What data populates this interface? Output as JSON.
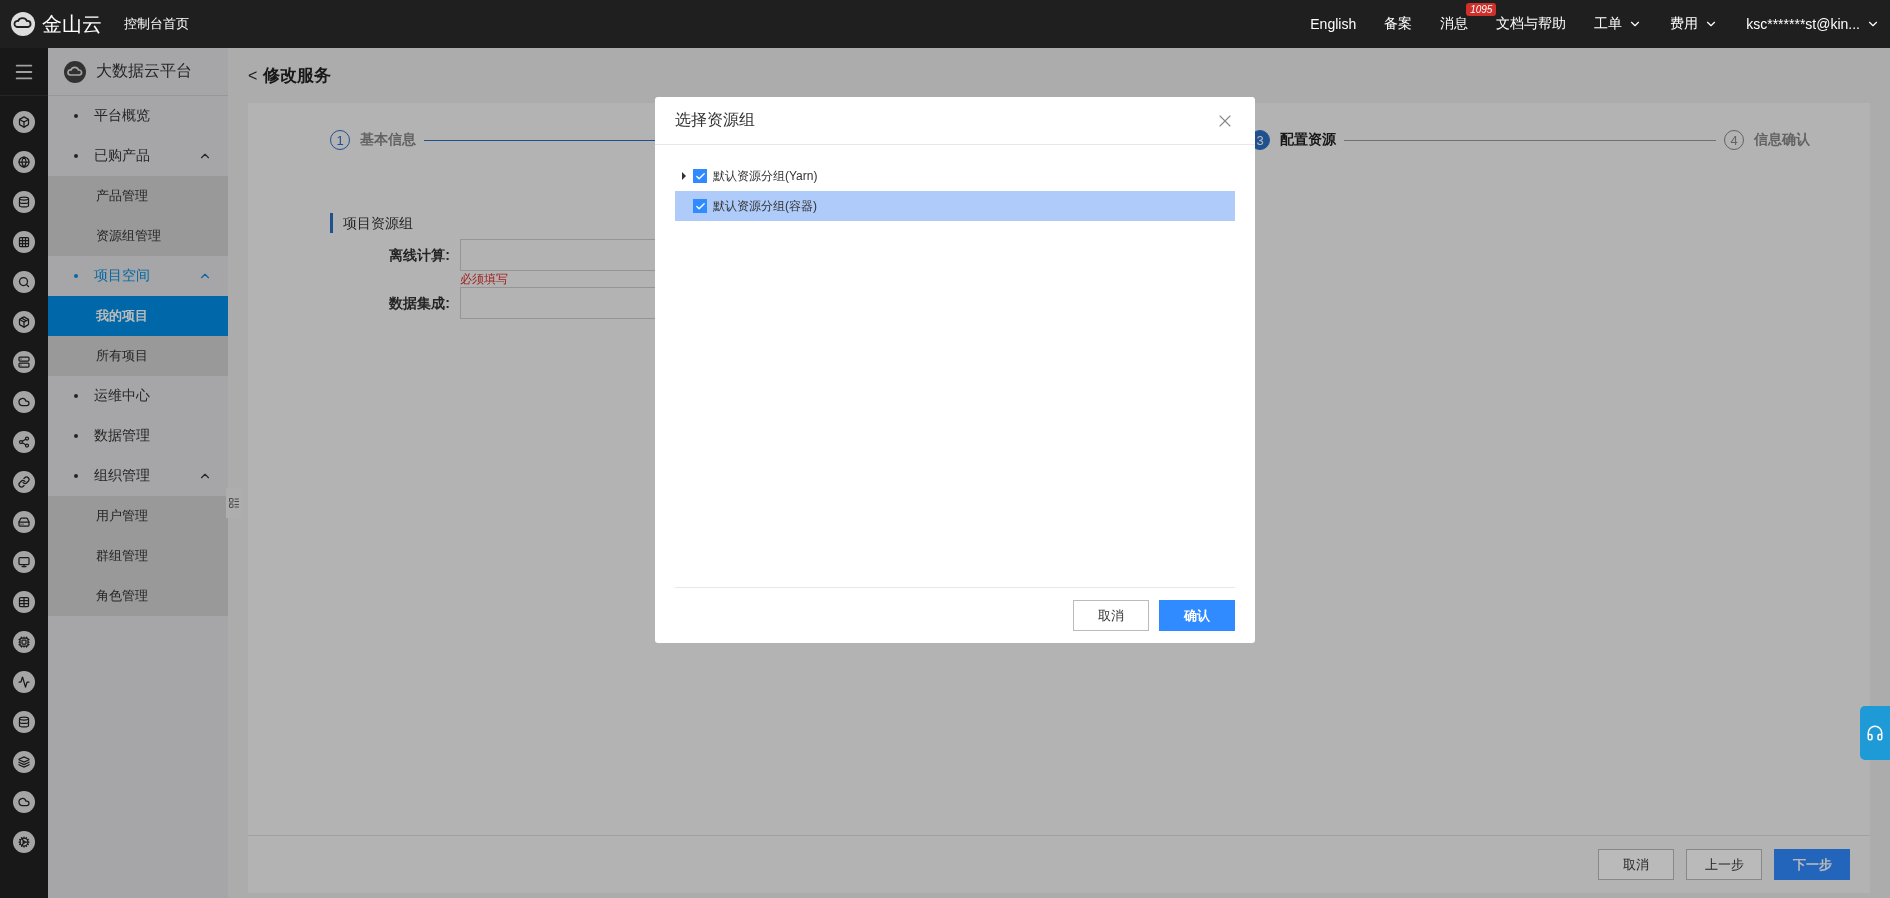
{
  "topbar": {
    "logo_text": "金山云",
    "home_link": "控制台首页",
    "nav": [
      {
        "label": "English",
        "kind": "link"
      },
      {
        "label": "备案",
        "kind": "link"
      },
      {
        "label": "消息",
        "kind": "badge",
        "badge": "1095"
      },
      {
        "label": "文档与帮助",
        "kind": "link"
      },
      {
        "label": "工单",
        "kind": "dropdown"
      },
      {
        "label": "费用",
        "kind": "dropdown"
      },
      {
        "label": "ksc*******st@kin...",
        "kind": "dropdown"
      }
    ]
  },
  "sidebar": {
    "title": "大数据云平台",
    "items": [
      {
        "label": "平台概览",
        "kind": "link",
        "selected": false
      },
      {
        "label": "已购产品",
        "kind": "group",
        "expanded": true,
        "selected": false,
        "children": [
          {
            "label": "产品管理",
            "selected": false
          },
          {
            "label": "资源组管理",
            "selected": false
          }
        ]
      },
      {
        "label": "项目空间",
        "kind": "group",
        "expanded": true,
        "selected": true,
        "children": [
          {
            "label": "我的项目",
            "selected": true
          },
          {
            "label": "所有项目",
            "selected": false
          }
        ]
      },
      {
        "label": "运维中心",
        "kind": "link",
        "selected": false
      },
      {
        "label": "数据管理",
        "kind": "link",
        "selected": false
      },
      {
        "label": "组织管理",
        "kind": "group",
        "expanded": true,
        "selected": false,
        "children": [
          {
            "label": "用户管理",
            "selected": false
          },
          {
            "label": "群组管理",
            "selected": false
          },
          {
            "label": "角色管理",
            "selected": false
          }
        ]
      }
    ]
  },
  "page": {
    "back": "<",
    "title": "修改服务",
    "steps": [
      {
        "number": "1",
        "label": "基本信息",
        "done": true,
        "active": false
      },
      {
        "number": "3",
        "label": "配置资源",
        "done": false,
        "active": true
      },
      {
        "number": "4",
        "label": "信息确认",
        "done": false,
        "active": false
      }
    ],
    "section": "项目资源组",
    "fields": [
      {
        "label": "离线计算:",
        "error": "必须填写"
      },
      {
        "label": "数据集成:"
      }
    ],
    "buttons": [
      {
        "label": "取消",
        "kind": "default"
      },
      {
        "label": "上一步",
        "kind": "default"
      },
      {
        "label": "下一步",
        "kind": "primary"
      }
    ]
  },
  "dialog": {
    "title": "选择资源组",
    "rows": [
      {
        "label": "默认资源分组(Yarn)",
        "kind": "branch",
        "expanded": false,
        "checked": true,
        "selected": false
      },
      {
        "label": "默认资源分组(容器)",
        "kind": "leaf",
        "checked": true,
        "selected": true
      }
    ],
    "buttons": [
      {
        "label": "取消",
        "kind": "default"
      },
      {
        "label": "确认",
        "kind": "primary"
      }
    ]
  }
}
